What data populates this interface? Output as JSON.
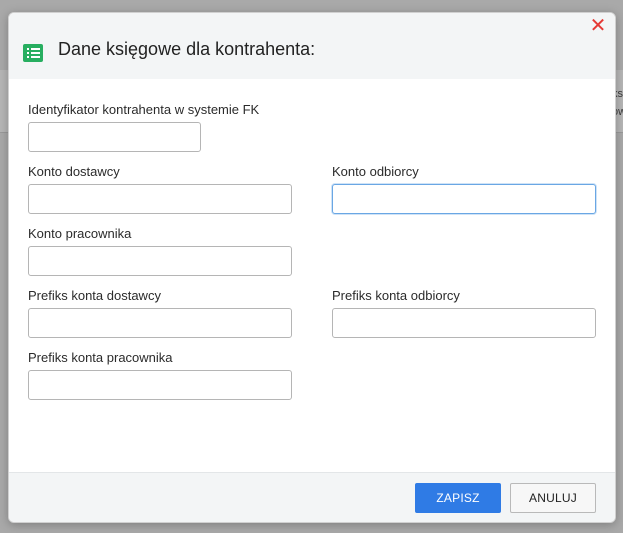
{
  "background": {
    "fragments": [
      "ks",
      "ow"
    ]
  },
  "dialog": {
    "title": "Dane księgowe dla kontrahenta:",
    "close_icon": "close-icon",
    "header_icon": "list-icon"
  },
  "fields": {
    "fk_id": {
      "label": "Identyfikator kontrahenta w systemie FK",
      "value": ""
    },
    "supplier_account": {
      "label": "Konto dostawcy",
      "value": ""
    },
    "customer_account": {
      "label": "Konto odbiorcy",
      "value": ""
    },
    "employee_account": {
      "label": "Konto pracownika",
      "value": ""
    },
    "supplier_prefix": {
      "label": "Prefiks konta dostawcy",
      "value": ""
    },
    "customer_prefix": {
      "label": "Prefiks konta odbiorcy",
      "value": ""
    },
    "employee_prefix": {
      "label": "Prefiks konta pracownika",
      "value": ""
    }
  },
  "footer": {
    "save_label": "ZAPISZ",
    "cancel_label": "ANULUJ"
  },
  "colors": {
    "primary": "#2f7be5",
    "close": "#e53935",
    "icon": "#27ae60"
  }
}
